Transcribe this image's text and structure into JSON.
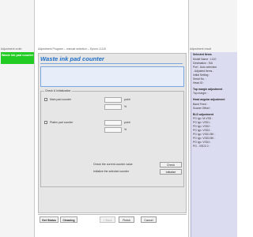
{
  "left_pane": {
    "header": "Adjustment order",
    "selected_item": "Waste ink pad counter"
  },
  "center": {
    "title_bar": "Adjustment Program – manual selection – Epson L1110",
    "heading": "Waste ink pad counter",
    "check_group_title": "Check & Initialization",
    "rows": [
      {
        "label": "Main pad counter",
        "unit_top": "point",
        "unit_bottom": "%"
      },
      {
        "label": "Platen pad counter",
        "unit_top": "point",
        "unit_bottom": "%"
      }
    ],
    "check_hint": "Check the current counter value",
    "init_hint": "Initialize the selected counter",
    "check_button": "Check",
    "initialize_button": "Initialize"
  },
  "bottom": {
    "tabs": [
      "Get Status",
      "Cleaning"
    ],
    "back_label": "< Back",
    "finish_label": "Finish",
    "cancel_label": "Cancel"
  },
  "right_pane": {
    "top_label": "Adjustment result",
    "items": [
      {
        "text": "Selected Items",
        "head": true
      },
      {
        "text": "Model Name : L110",
        "head": false
      },
      {
        "text": "Destination : EAI",
        "head": false
      },
      {
        "text": "Port : Auto selection",
        "head": false
      },
      {
        "text": "- Adjusted Items -",
        "head": false
      },
      {
        "text": "Initial Setting :",
        "head": false
      },
      {
        "text": "Serial No. :",
        "head": false
      },
      {
        "text": "Head ID :",
        "head": false
      },
      {
        "text": "Top margin adjustment",
        "head": true
      },
      {
        "text": "Top margin :",
        "head": false
      },
      {
        "text": "Head angular adjustment",
        "head": true
      },
      {
        "text": "Band Feed :",
        "head": false
      },
      {
        "text": "Scaner Offset :",
        "head": false
      },
      {
        "text": "Bi-D adjustment",
        "head": true
      },
      {
        "text": "PG typ: M-VSD :",
        "head": false
      },
      {
        "text": "PG typ: VSD1 :",
        "head": false
      },
      {
        "text": "PG typ: VSD2 :",
        "head": false
      },
      {
        "text": "PG typ: VSD3 :",
        "head": false
      },
      {
        "text": "PG typ: VSD1 BK :",
        "head": false
      },
      {
        "text": "PG typ: VSD3 BK :",
        "head": false
      },
      {
        "text": "PG typ: VSD4 :",
        "head": false
      },
      {
        "text": "PG - VSD3 2 :",
        "head": false
      }
    ]
  }
}
